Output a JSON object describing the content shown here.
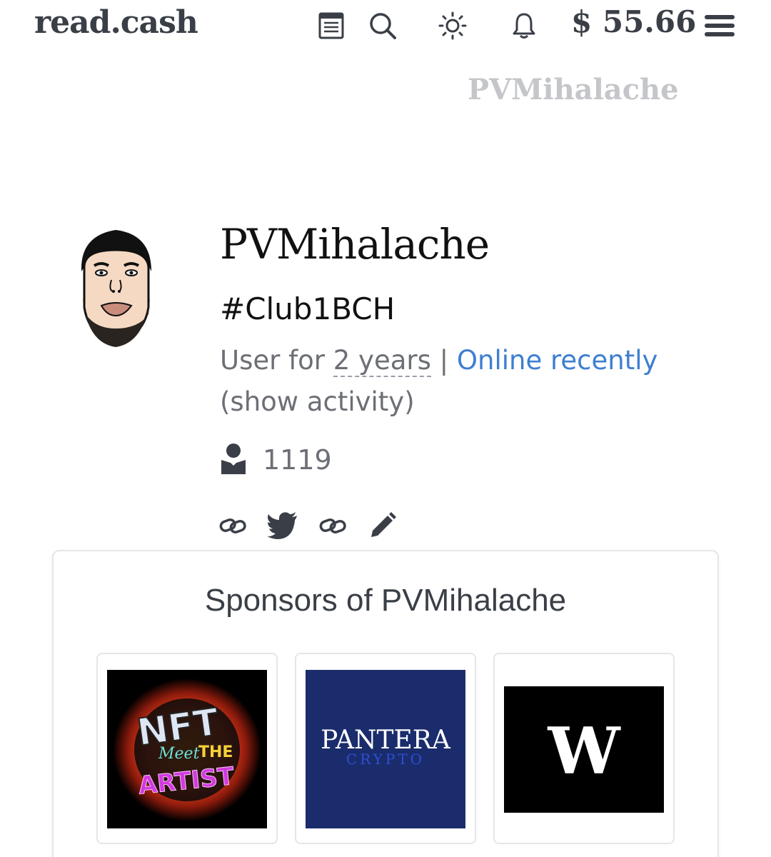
{
  "header": {
    "logo": "read.cash",
    "balance": "$ 55.66",
    "icons": [
      "feed-icon",
      "search-icon",
      "theme-toggle-icon",
      "bell-icon",
      "menu-icon"
    ]
  },
  "page": {
    "watermark": "PVMihalache"
  },
  "profile": {
    "name": "PVMihalache",
    "tag": "#Club1BCH",
    "user_for_prefix": "User for",
    "user_for_duration": "2 years",
    "separator": "|",
    "status": "Online recently",
    "activity_link": "(show activity)",
    "followers": "1119"
  },
  "socials": [
    "link-icon",
    "twitter-icon",
    "link-icon",
    "edit-icon"
  ],
  "sponsors": {
    "title": "Sponsors of PVMihalache",
    "items": [
      {
        "name": "NFT Meet the Artist",
        "logo_text_1": "NFT",
        "logo_text_2": "Meet",
        "logo_text_3": "THE",
        "logo_text_4": "ARTIST"
      },
      {
        "name": "Pantera Crypto",
        "logo_text_1": "PANTERA",
        "logo_text_2": "CRYPTO",
        "bg": "#1a2c6b"
      },
      {
        "name": "W",
        "logo_text_1": "W",
        "bg": "#000000"
      }
    ]
  },
  "colors": {
    "link_blue": "#3d7fd1",
    "text_dark": "#3a3f47",
    "muted": "#6c6f75"
  }
}
